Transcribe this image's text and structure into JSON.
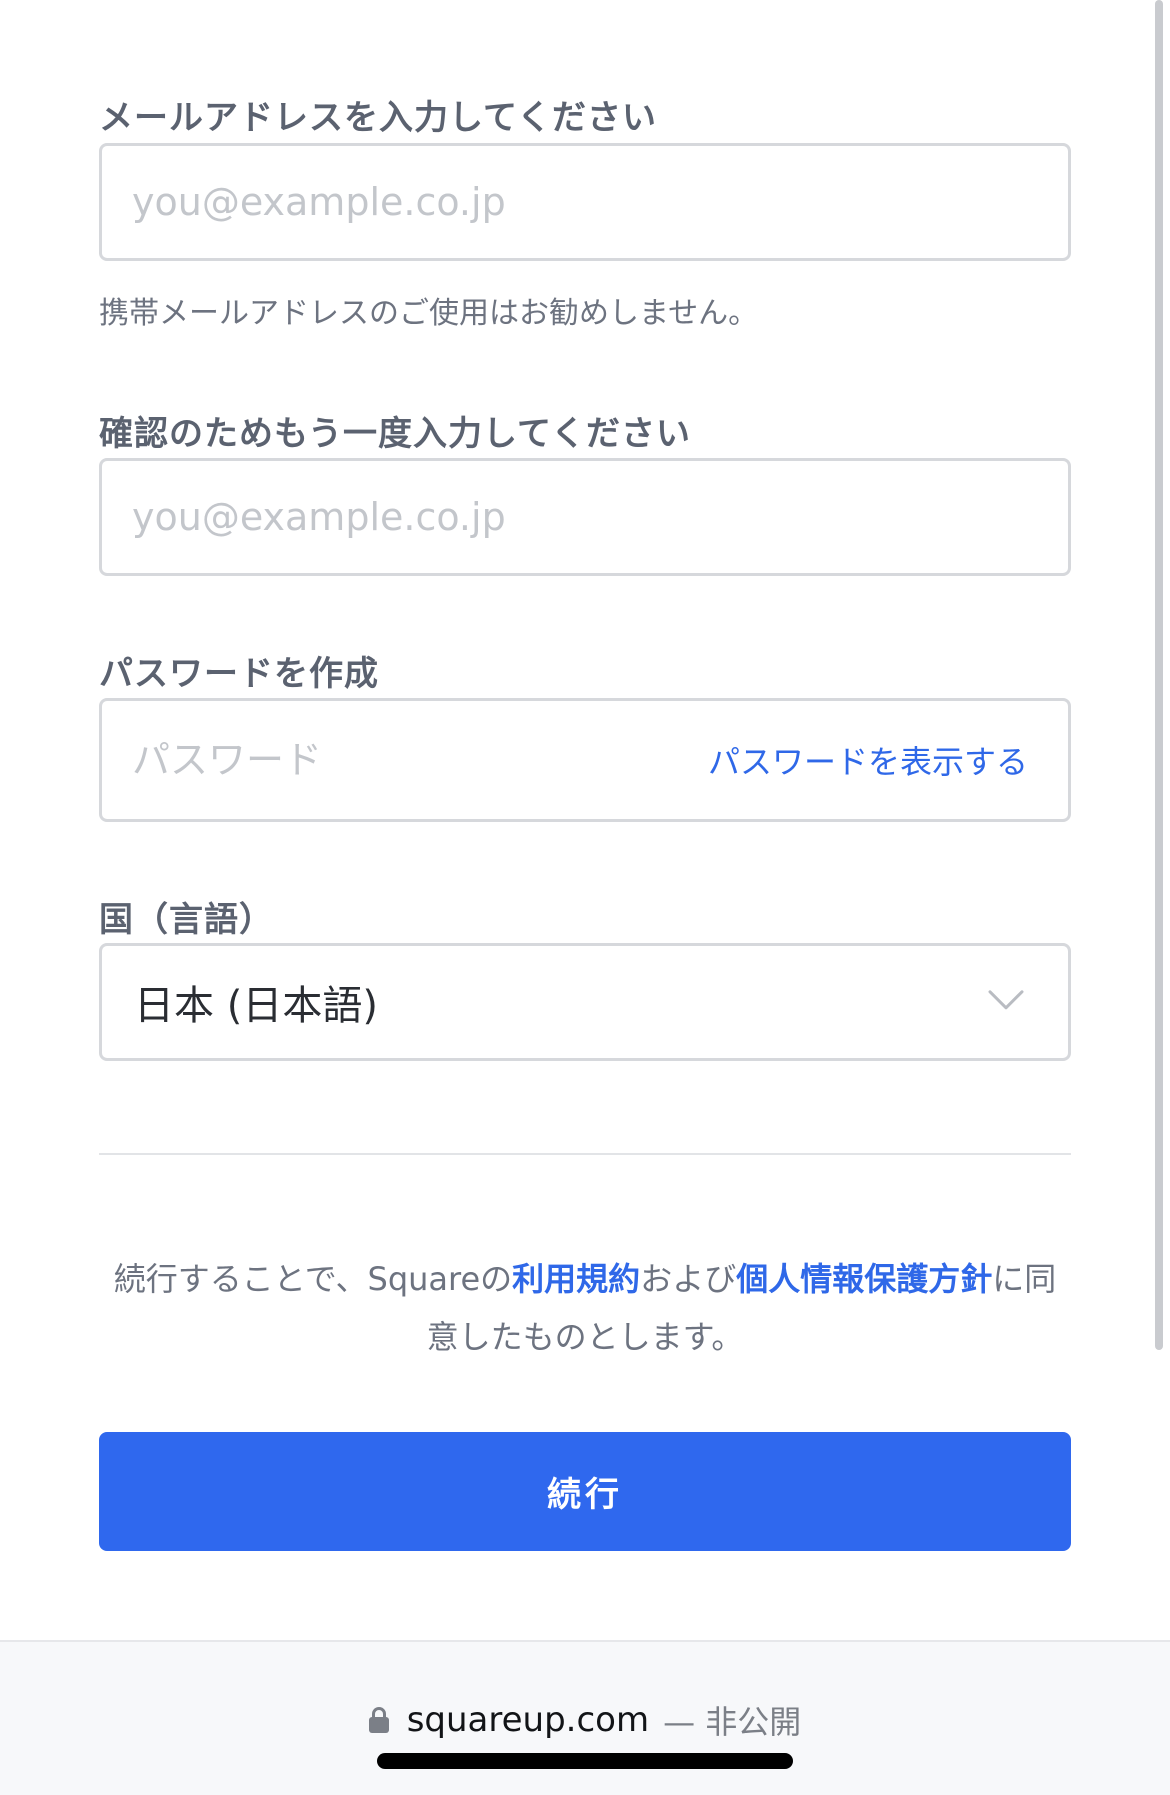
{
  "form": {
    "email": {
      "label": "メールアドレスを入力してください",
      "placeholder": "you@example.co.jp",
      "value": "",
      "hint": "携帯メールアドレスのご使用はお勧めしません。"
    },
    "email_confirm": {
      "label": "確認のためもう一度入力してください",
      "placeholder": "you@example.co.jp",
      "value": ""
    },
    "password": {
      "label": "パスワードを作成",
      "placeholder": "パスワード",
      "value": "",
      "show_label": "パスワードを表示する"
    },
    "country": {
      "label": "国（言語）",
      "selected": "日本 (日本語)"
    }
  },
  "terms": {
    "prefix": "続行することで、Squareの",
    "terms_link": "利用規約",
    "middle": "および",
    "privacy_link": "個人情報保護方針",
    "suffix": "に同意したものとします。"
  },
  "continue_label": "続行",
  "browser": {
    "domain": "squareup.com",
    "status": "— 非公開"
  },
  "colors": {
    "accent": "#2f68ee",
    "link": "#2f68e8",
    "label": "#5b6270",
    "border": "#d6d8dc"
  },
  "icons": {
    "lock": "lock-icon",
    "chevron": "chevron-down-icon"
  }
}
